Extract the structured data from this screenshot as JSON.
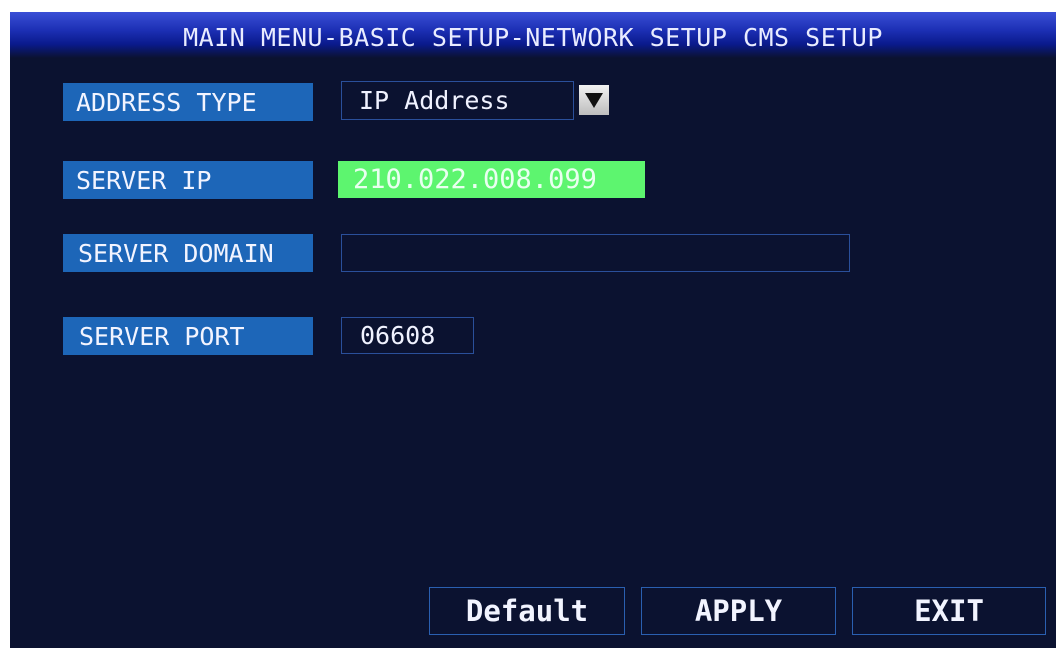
{
  "title": "MAIN MENU-BASIC SETUP-NETWORK SETUP CMS SETUP",
  "fields": {
    "address_type": {
      "label": "ADDRESS TYPE",
      "value": "IP Address",
      "arrow_icon": "dropdown-arrow-icon"
    },
    "server_ip": {
      "label": "SERVER IP",
      "value": "210.022.008.099"
    },
    "server_domain": {
      "label": "SERVER DOMAIN",
      "value": ""
    },
    "server_port": {
      "label": "SERVER PORT",
      "value": "06608"
    }
  },
  "buttons": {
    "default_label": "Default",
    "apply_label": "APPLY",
    "exit_label": "EXIT"
  },
  "colors": {
    "background": "#0b1230",
    "label_blue": "#1d66b8",
    "highlight_green": "#5df56f"
  }
}
